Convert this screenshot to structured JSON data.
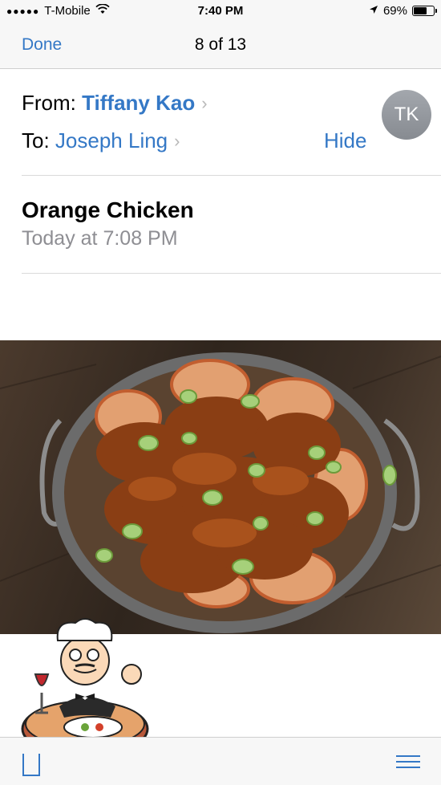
{
  "status_bar": {
    "signal_dots": "●●●●●",
    "carrier": "T-Mobile",
    "time": "7:40 PM",
    "battery_percent": "69%",
    "battery_level": 0.69
  },
  "nav": {
    "done_label": "Done",
    "message_counter": "8 of 13"
  },
  "header": {
    "from_label": "From:",
    "from_name": "Tiffany Kao",
    "to_label": "To:",
    "to_name": "Joseph Ling",
    "hide_label": "Hide",
    "avatar_initials": "TK"
  },
  "message": {
    "subject": "Orange Chicken",
    "date": "Today at 7:08 PM"
  },
  "icons": {
    "wifi": "wifi-icon",
    "location": "location-arrow-icon",
    "battery": "battery-icon",
    "chevron": "chevron-right-icon",
    "flag": "flag-icon",
    "list": "list-icon"
  },
  "colors": {
    "accent": "#3478c6",
    "secondary_text": "#8e8e93",
    "avatar": "#969aa0"
  }
}
